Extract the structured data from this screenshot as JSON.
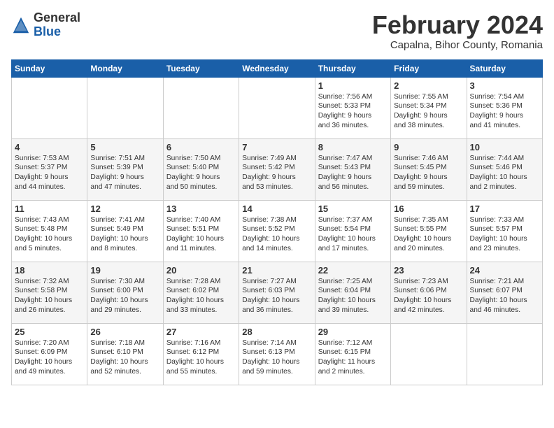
{
  "header": {
    "logo_general": "General",
    "logo_blue": "Blue",
    "month_title": "February 2024",
    "subtitle": "Capalna, Bihor County, Romania"
  },
  "weekdays": [
    "Sunday",
    "Monday",
    "Tuesday",
    "Wednesday",
    "Thursday",
    "Friday",
    "Saturday"
  ],
  "weeks": [
    [
      {
        "day": "",
        "content": ""
      },
      {
        "day": "",
        "content": ""
      },
      {
        "day": "",
        "content": ""
      },
      {
        "day": "",
        "content": ""
      },
      {
        "day": "1",
        "content": "Sunrise: 7:56 AM\nSunset: 5:33 PM\nDaylight: 9 hours\nand 36 minutes."
      },
      {
        "day": "2",
        "content": "Sunrise: 7:55 AM\nSunset: 5:34 PM\nDaylight: 9 hours\nand 38 minutes."
      },
      {
        "day": "3",
        "content": "Sunrise: 7:54 AM\nSunset: 5:36 PM\nDaylight: 9 hours\nand 41 minutes."
      }
    ],
    [
      {
        "day": "4",
        "content": "Sunrise: 7:53 AM\nSunset: 5:37 PM\nDaylight: 9 hours\nand 44 minutes."
      },
      {
        "day": "5",
        "content": "Sunrise: 7:51 AM\nSunset: 5:39 PM\nDaylight: 9 hours\nand 47 minutes."
      },
      {
        "day": "6",
        "content": "Sunrise: 7:50 AM\nSunset: 5:40 PM\nDaylight: 9 hours\nand 50 minutes."
      },
      {
        "day": "7",
        "content": "Sunrise: 7:49 AM\nSunset: 5:42 PM\nDaylight: 9 hours\nand 53 minutes."
      },
      {
        "day": "8",
        "content": "Sunrise: 7:47 AM\nSunset: 5:43 PM\nDaylight: 9 hours\nand 56 minutes."
      },
      {
        "day": "9",
        "content": "Sunrise: 7:46 AM\nSunset: 5:45 PM\nDaylight: 9 hours\nand 59 minutes."
      },
      {
        "day": "10",
        "content": "Sunrise: 7:44 AM\nSunset: 5:46 PM\nDaylight: 10 hours\nand 2 minutes."
      }
    ],
    [
      {
        "day": "11",
        "content": "Sunrise: 7:43 AM\nSunset: 5:48 PM\nDaylight: 10 hours\nand 5 minutes."
      },
      {
        "day": "12",
        "content": "Sunrise: 7:41 AM\nSunset: 5:49 PM\nDaylight: 10 hours\nand 8 minutes."
      },
      {
        "day": "13",
        "content": "Sunrise: 7:40 AM\nSunset: 5:51 PM\nDaylight: 10 hours\nand 11 minutes."
      },
      {
        "day": "14",
        "content": "Sunrise: 7:38 AM\nSunset: 5:52 PM\nDaylight: 10 hours\nand 14 minutes."
      },
      {
        "day": "15",
        "content": "Sunrise: 7:37 AM\nSunset: 5:54 PM\nDaylight: 10 hours\nand 17 minutes."
      },
      {
        "day": "16",
        "content": "Sunrise: 7:35 AM\nSunset: 5:55 PM\nDaylight: 10 hours\nand 20 minutes."
      },
      {
        "day": "17",
        "content": "Sunrise: 7:33 AM\nSunset: 5:57 PM\nDaylight: 10 hours\nand 23 minutes."
      }
    ],
    [
      {
        "day": "18",
        "content": "Sunrise: 7:32 AM\nSunset: 5:58 PM\nDaylight: 10 hours\nand 26 minutes."
      },
      {
        "day": "19",
        "content": "Sunrise: 7:30 AM\nSunset: 6:00 PM\nDaylight: 10 hours\nand 29 minutes."
      },
      {
        "day": "20",
        "content": "Sunrise: 7:28 AM\nSunset: 6:02 PM\nDaylight: 10 hours\nand 33 minutes."
      },
      {
        "day": "21",
        "content": "Sunrise: 7:27 AM\nSunset: 6:03 PM\nDaylight: 10 hours\nand 36 minutes."
      },
      {
        "day": "22",
        "content": "Sunrise: 7:25 AM\nSunset: 6:04 PM\nDaylight: 10 hours\nand 39 minutes."
      },
      {
        "day": "23",
        "content": "Sunrise: 7:23 AM\nSunset: 6:06 PM\nDaylight: 10 hours\nand 42 minutes."
      },
      {
        "day": "24",
        "content": "Sunrise: 7:21 AM\nSunset: 6:07 PM\nDaylight: 10 hours\nand 46 minutes."
      }
    ],
    [
      {
        "day": "25",
        "content": "Sunrise: 7:20 AM\nSunset: 6:09 PM\nDaylight: 10 hours\nand 49 minutes."
      },
      {
        "day": "26",
        "content": "Sunrise: 7:18 AM\nSunset: 6:10 PM\nDaylight: 10 hours\nand 52 minutes."
      },
      {
        "day": "27",
        "content": "Sunrise: 7:16 AM\nSunset: 6:12 PM\nDaylight: 10 hours\nand 55 minutes."
      },
      {
        "day": "28",
        "content": "Sunrise: 7:14 AM\nSunset: 6:13 PM\nDaylight: 10 hours\nand 59 minutes."
      },
      {
        "day": "29",
        "content": "Sunrise: 7:12 AM\nSunset: 6:15 PM\nDaylight: 11 hours\nand 2 minutes."
      },
      {
        "day": "",
        "content": ""
      },
      {
        "day": "",
        "content": ""
      }
    ]
  ]
}
